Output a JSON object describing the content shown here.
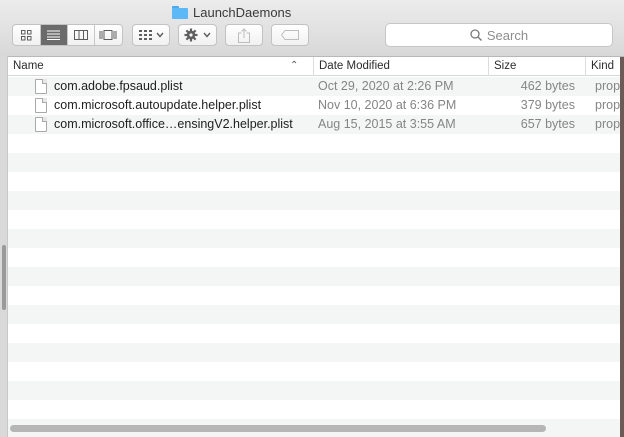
{
  "window": {
    "title": "LaunchDaemons"
  },
  "toolbar": {
    "view_modes": [
      "icon-view",
      "list-view",
      "column-view",
      "cover-flow-view"
    ],
    "active_view": "list-view",
    "group_button": "group-by",
    "action_button": "action-gear",
    "share_button": "share",
    "tag_button": "edit-tags"
  },
  "search": {
    "placeholder": "Search"
  },
  "columns": {
    "name": "Name",
    "date": "Date Modified",
    "size": "Size",
    "kind": "Kind"
  },
  "files": [
    {
      "name": "com.adobe.fpsaud.plist",
      "date": "Oct 29, 2020 at 2:26 PM",
      "size": "462 bytes",
      "kind": "prop"
    },
    {
      "name": "com.microsoft.autoupdate.helper.plist",
      "date": "Nov 10, 2020 at 6:36 PM",
      "size": "379 bytes",
      "kind": "prop"
    },
    {
      "name": "com.microsoft.office…ensingV2.helper.plist",
      "date": "Aug 15, 2015 at 3:55 AM",
      "size": "657 bytes",
      "kind": "prop"
    }
  ],
  "empty_rows": 16,
  "colors": {
    "folder": "#5cb8f6",
    "active_segment": "#6b6b6b",
    "secondary_text": "#858585"
  }
}
